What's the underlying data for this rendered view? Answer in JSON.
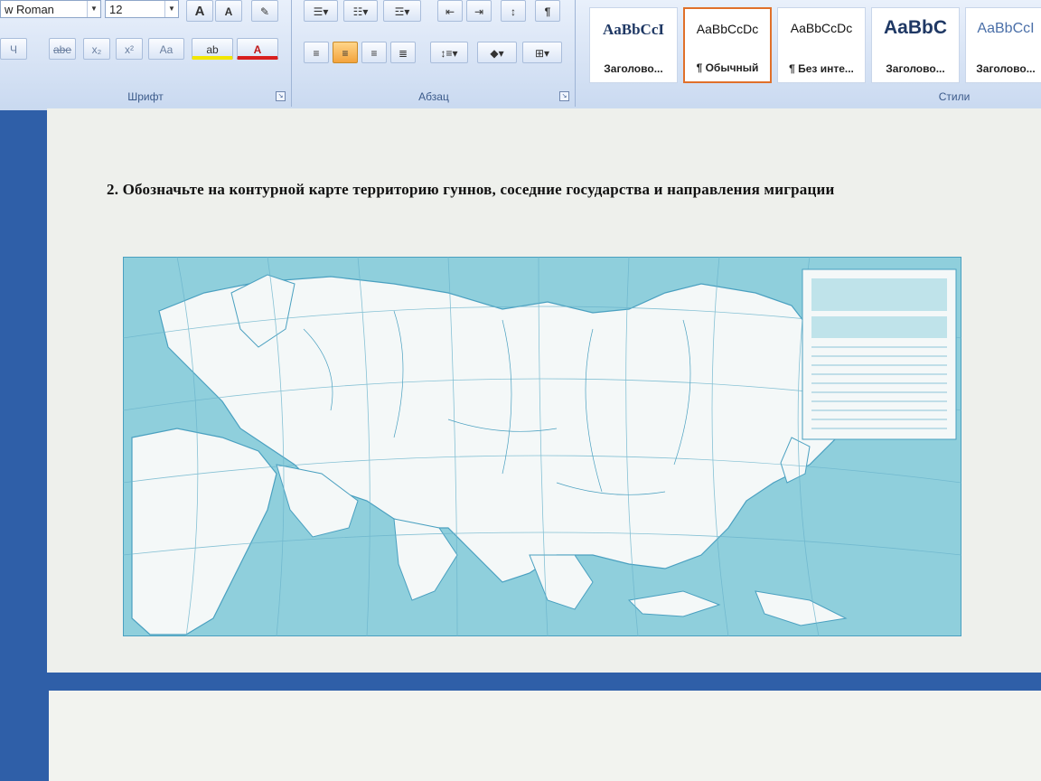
{
  "ribbon": {
    "font_group": {
      "label": "Шрифт",
      "font_name": "w Roman",
      "font_size": "12",
      "grow_glyph": "A",
      "shrink_glyph": "A",
      "underline_glyph": "Ч",
      "strike_glyph": "abe",
      "sub_glyph": "x₂",
      "sup_glyph": "x²",
      "case_glyph": "Aa",
      "highlight_glyph": "ab",
      "color_glyph": "A"
    },
    "paragraph_group": {
      "label": "Абзац",
      "show_marks_glyph": "¶"
    },
    "styles_group": {
      "label": "Стили",
      "tiles": [
        {
          "sample": "AaBbCcI",
          "name": "Заголово..."
        },
        {
          "sample": "AaBbCcDc",
          "name": "¶ Обычный"
        },
        {
          "sample": "AaBbCcDc",
          "name": "¶ Без инте..."
        },
        {
          "sample": "AaBbC",
          "name": "Заголово..."
        },
        {
          "sample": "AaBbCcI",
          "name": "Заголово..."
        }
      ]
    }
  },
  "document": {
    "question": "2. Обозначьте на контурной карте территорию гуннов, соседние государства и направления миграции"
  },
  "colors": {
    "sea": "#8fcfdc",
    "land": "#f4f8f8",
    "contour": "#4aa0c0",
    "selected_style_border": "#e0702a"
  }
}
